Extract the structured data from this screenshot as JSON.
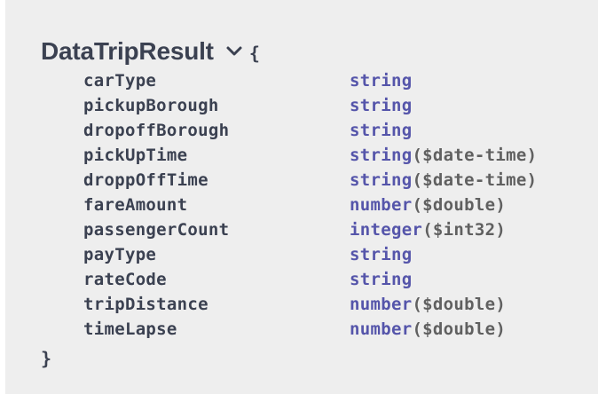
{
  "model": {
    "title": "DataTripResult",
    "open_brace": "{",
    "close_brace": "}",
    "toggle_icon": "chevron-down-icon",
    "properties": [
      {
        "name": "carType",
        "type": "string",
        "format": ""
      },
      {
        "name": "pickupBorough",
        "type": "string",
        "format": ""
      },
      {
        "name": "dropoffBorough",
        "type": "string",
        "format": ""
      },
      {
        "name": "pickUpTime",
        "type": "string",
        "format": "($date-time)"
      },
      {
        "name": "droppOffTime",
        "type": "string",
        "format": "($date-time)"
      },
      {
        "name": "fareAmount",
        "type": "number",
        "format": "($double)"
      },
      {
        "name": "passengerCount",
        "type": "integer",
        "format": "($int32)"
      },
      {
        "name": "payType",
        "type": "string",
        "format": ""
      },
      {
        "name": "rateCode",
        "type": "string",
        "format": ""
      },
      {
        "name": "tripDistance",
        "type": "number",
        "format": "($double)"
      },
      {
        "name": "timeLapse",
        "type": "number",
        "format": "($double)"
      }
    ]
  },
  "colors": {
    "background": "#eeeeee",
    "title": "#3b4151",
    "type": "#5555aa",
    "format": "#606060"
  }
}
